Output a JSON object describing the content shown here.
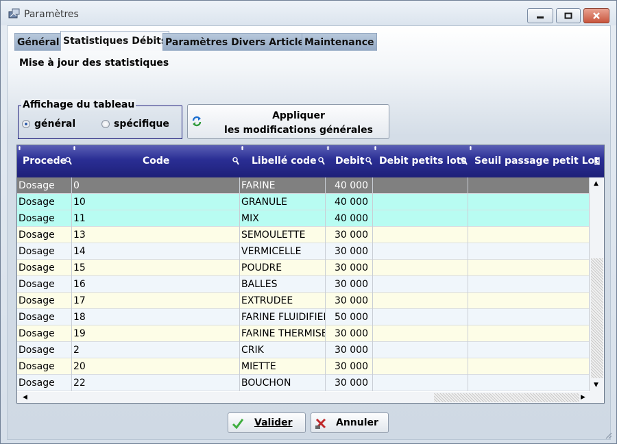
{
  "window": {
    "title": "Paramètres"
  },
  "tabs": [
    {
      "label": "Général"
    },
    {
      "label": "Statistiques Débits"
    },
    {
      "label": "Paramètres Divers Article"
    },
    {
      "label": "Maintenance"
    }
  ],
  "page_subtitle": "Mise à jour des statistiques",
  "display_group": {
    "legend": "Affichage du tableau",
    "options": [
      {
        "label": "général",
        "selected": true
      },
      {
        "label": "spécifique",
        "selected": false
      }
    ]
  },
  "apply_button": {
    "line1": "Appliquer",
    "line2": "les modifications générales"
  },
  "table": {
    "columns": [
      {
        "label": "Procede"
      },
      {
        "label": "Code"
      },
      {
        "label": "Libellé code"
      },
      {
        "label": "Debit"
      },
      {
        "label": "Debit petits lots"
      },
      {
        "label": "Seuil passage petit Lot"
      }
    ],
    "rows": [
      {
        "procede": "Dosage",
        "code": "0",
        "libelle": "FARINE",
        "debit": "40 000",
        "debit_petits_lots": "",
        "seuil": "",
        "style": "selected"
      },
      {
        "procede": "Dosage",
        "code": "10",
        "libelle": "GRANULE",
        "debit": "40 000",
        "debit_petits_lots": "",
        "seuil": "",
        "style": "cyan"
      },
      {
        "procede": "Dosage",
        "code": "11",
        "libelle": "MIX",
        "debit": "40 000",
        "debit_petits_lots": "",
        "seuil": "",
        "style": "cyan"
      },
      {
        "procede": "Dosage",
        "code": "13",
        "libelle": "SEMOULETTE",
        "debit": "30 000",
        "debit_petits_lots": "",
        "seuil": "",
        "style": "cream"
      },
      {
        "procede": "Dosage",
        "code": "14",
        "libelle": "VERMICELLE",
        "debit": "30 000",
        "debit_petits_lots": "",
        "seuil": "",
        "style": "light"
      },
      {
        "procede": "Dosage",
        "code": "15",
        "libelle": "POUDRE",
        "debit": "30 000",
        "debit_petits_lots": "",
        "seuil": "",
        "style": "cream"
      },
      {
        "procede": "Dosage",
        "code": "16",
        "libelle": "BALLES",
        "debit": "30 000",
        "debit_petits_lots": "",
        "seuil": "",
        "style": "light"
      },
      {
        "procede": "Dosage",
        "code": "17",
        "libelle": "EXTRUDEE",
        "debit": "30 000",
        "debit_petits_lots": "",
        "seuil": "",
        "style": "cream"
      },
      {
        "procede": "Dosage",
        "code": "18",
        "libelle": "FARINE FLUIDIFIEI",
        "debit": "50 000",
        "debit_petits_lots": "",
        "seuil": "",
        "style": "light"
      },
      {
        "procede": "Dosage",
        "code": "19",
        "libelle": "FARINE THERMISE",
        "debit": "30 000",
        "debit_petits_lots": "",
        "seuil": "",
        "style": "cream"
      },
      {
        "procede": "Dosage",
        "code": "2",
        "libelle": "CRIK",
        "debit": "30 000",
        "debit_petits_lots": "",
        "seuil": "",
        "style": "light"
      },
      {
        "procede": "Dosage",
        "code": "20",
        "libelle": "MIETTE",
        "debit": "30 000",
        "debit_petits_lots": "",
        "seuil": "",
        "style": "cream"
      },
      {
        "procede": "Dosage",
        "code": "22",
        "libelle": "BOUCHON",
        "debit": "30 000",
        "debit_petits_lots": "",
        "seuil": "",
        "style": "light"
      }
    ]
  },
  "footer": {
    "ok_label": "Valider",
    "cancel_label": "Annuler"
  },
  "colors": {
    "header_bg": "#2a2e94",
    "selected_row": "#808080",
    "cyan_row": "#b8fcf2",
    "cream_row": "#fdfde7",
    "light_row": "#f0f6fb"
  }
}
